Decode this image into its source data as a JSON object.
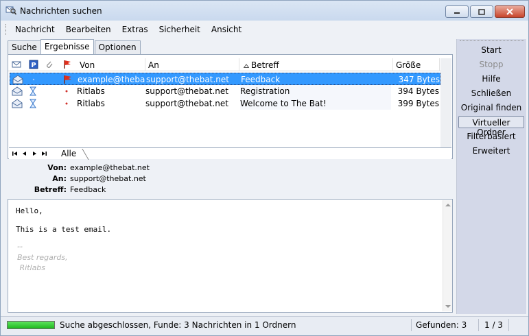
{
  "window": {
    "title": "Nachrichten suchen"
  },
  "menubar": {
    "items": [
      "Nachricht",
      "Bearbeiten",
      "Extras",
      "Sicherheit",
      "Ansicht"
    ],
    "extra_icon": "sun-icon"
  },
  "tabs": [
    "Suche",
    "Ergebnisse",
    "Optionen"
  ],
  "active_tab": "Ergebnisse",
  "columns": {
    "from": "Von",
    "to": "An",
    "subject": "Betreff",
    "size": "Größe"
  },
  "header_icons": [
    "envelope-icon",
    "priority-icon",
    "attachment-icon",
    "flag-icon"
  ],
  "results": [
    {
      "from": "example@theba...",
      "to": "support@thebat.net",
      "subject": "Feedback",
      "size": "347 Bytes",
      "selected": true
    },
    {
      "from": "Ritlabs",
      "to": "support@thebat.net",
      "subject": "Registration",
      "size": "394 Bytes",
      "selected": false
    },
    {
      "from": "Ritlabs",
      "to": "support@thebat.net",
      "subject": "Welcome to The Bat!",
      "size": "399 Bytes",
      "selected": false
    }
  ],
  "nav_strip": {
    "tab_label": "Alle"
  },
  "message_header": {
    "from_label": "Von:",
    "from_value": "example@thebat.net",
    "to_label": "An:",
    "to_value": "support@thebat.net",
    "subject_label": "Betreff:",
    "subject_value": "Feedback"
  },
  "message_body": {
    "lines": [
      "Hello,",
      "This is a test email."
    ],
    "signature": [
      "--",
      "Best regards,",
      " Ritlabs"
    ]
  },
  "side_buttons": [
    {
      "label": "Start",
      "disabled": false
    },
    {
      "label": "Stopp",
      "disabled": true
    },
    {
      "label": "Hilfe",
      "disabled": false
    },
    {
      "label": "Schließen",
      "disabled": false
    },
    {
      "label": "Original finden",
      "disabled": false
    },
    {
      "label": "Virtueller Ordner",
      "disabled": false
    },
    {
      "label": "Filterbasiert",
      "disabled": false
    },
    {
      "label": "Erweitert",
      "disabled": false
    }
  ],
  "status": {
    "progress": 1.0,
    "text": "Suche abgeschlossen, Funde: 3 Nachrichten in 1 Ordnern",
    "found": "Gefunden: 3",
    "pager": "1 / 3"
  },
  "colors": {
    "selection": "#3399ff",
    "flag": "#e0301e",
    "progress": "#1fb81f"
  }
}
